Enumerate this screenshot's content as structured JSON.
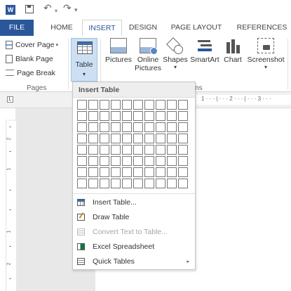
{
  "qat": {
    "app_icon_text": "W",
    "undo_glyph": "↶",
    "undo_dropdown_glyph": "▾",
    "redo_glyph": "↷",
    "more_glyph": "▾"
  },
  "tabs": [
    {
      "label": "FILE"
    },
    {
      "label": "HOME"
    },
    {
      "label": "INSERT"
    },
    {
      "label": "DESIGN"
    },
    {
      "label": "PAGE LAYOUT"
    },
    {
      "label": "REFERENCES"
    }
  ],
  "ribbon": {
    "pages_group": {
      "label": "Pages",
      "cover_page": "Cover Page",
      "blank_page": "Blank Page",
      "page_break": "Page Break"
    },
    "table_button": {
      "label": "Table"
    },
    "illustrations": {
      "partial_label": "ations",
      "pictures": "Pictures",
      "online_pictures_l1": "Online",
      "online_pictures_l2": "Pictures",
      "shapes": "Shapes",
      "smartart": "SmartArt",
      "chart": "Chart",
      "screenshot": "Screenshot"
    },
    "caret_glyph": "▾"
  },
  "ruler": {
    "corner_glyph": "L",
    "top_marks": "1 · · · | · · · 2 · · · | · · · 3 · · ·",
    "v_numbers": [
      "2",
      "1",
      "1",
      "2"
    ]
  },
  "insert_table_menu": {
    "header": "Insert Table",
    "grid_rows": 8,
    "grid_cols": 10,
    "items": [
      {
        "label": "Insert Table...",
        "icon": "insert-table-icon",
        "enabled": true
      },
      {
        "label": "Draw Table",
        "icon": "draw-table-icon",
        "enabled": true
      },
      {
        "label": "Convert Text to Table...",
        "icon": "convert-text-icon",
        "enabled": false
      },
      {
        "label": "Excel Spreadsheet",
        "icon": "excel-icon",
        "enabled": true
      },
      {
        "label": "Quick Tables",
        "icon": "quick-tables-icon",
        "enabled": true,
        "submenu_glyph": "▸"
      }
    ]
  },
  "colors": {
    "brand_blue": "#2b579a",
    "selected_button_bg": "#cde0f3"
  }
}
